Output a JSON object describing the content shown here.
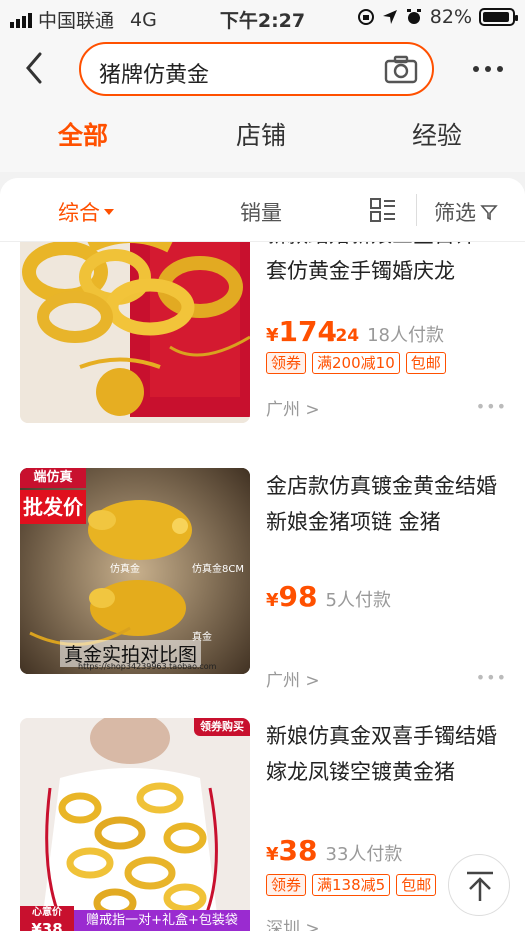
{
  "status": {
    "carrier": "中国联通",
    "network": "4G",
    "time": "下午2:27",
    "battery": "82%"
  },
  "search": {
    "query": "猪牌仿黄金"
  },
  "tabs": [
    {
      "label": "全部",
      "active": true
    },
    {
      "label": "店铺",
      "active": false
    },
    {
      "label": "经验",
      "active": false
    }
  ],
  "filters": {
    "sort": "综合",
    "sales": "销量",
    "filter": "筛选"
  },
  "items": [
    {
      "title": "新款结婚新娘三金首饰一套仿黄金手镯婚庆龙",
      "currency": "¥",
      "price": "174",
      "decimal": ".24",
      "sold": "18人付款",
      "tags": [
        "领券",
        "满200减10",
        "包邮"
      ],
      "location": "广州 >",
      "more": "•••"
    },
    {
      "title": "金店款仿真镀金黄金结婚新娘金猪项链 金猪",
      "currency": "¥",
      "price": "98",
      "decimal": "",
      "sold": "5人付款",
      "tags": [],
      "location": "广州 >",
      "more": "•••",
      "image_text": {
        "corner": "端仿真",
        "badge": "批发价",
        "label1": "仿真金",
        "label2": "仿真金8CM",
        "label3": "真金",
        "caption": "真金实拍对比图",
        "url": "https://shop34239963.taobao.com"
      }
    },
    {
      "title": "新娘仿真金双喜手镯结婚嫁龙凤镂空镀黄金猪",
      "currency": "¥",
      "price": "38",
      "decimal": "",
      "sold": "33人付款",
      "tags": [
        "领券",
        "满138减5",
        "包邮"
      ],
      "location": "深圳 >",
      "more": "•••",
      "image_text": {
        "corner": "领券购买",
        "promo": "赠戒指一对+礼盒+包装袋",
        "small": "心意价",
        "price": "¥38"
      }
    }
  ],
  "colors": {
    "accent": "#ff5000",
    "gold": "#e9b527"
  }
}
